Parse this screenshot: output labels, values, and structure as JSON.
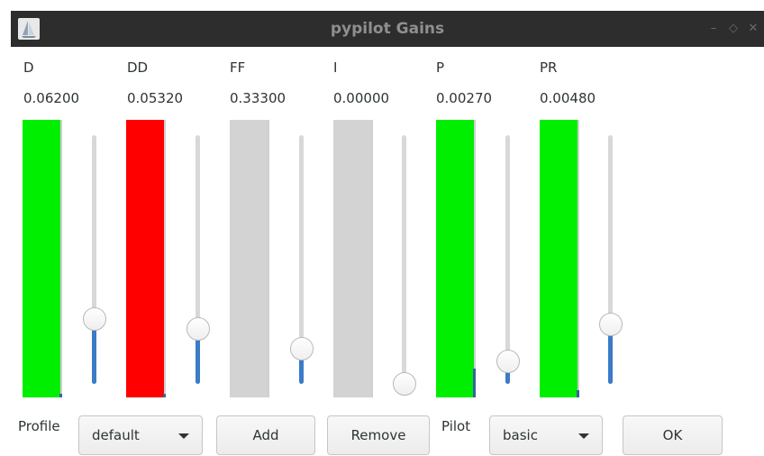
{
  "window": {
    "title": "pypilot Gains"
  },
  "gains": [
    {
      "name": "D",
      "value": "0.06200",
      "bar_color": "#00ee00",
      "bar_fill": 1.0,
      "slider_level": 0.26
    },
    {
      "name": "DD",
      "value": "0.05320",
      "bar_color": "#ff0000",
      "bar_fill": 1.0,
      "slider_level": 0.22
    },
    {
      "name": "FF",
      "value": "0.33300",
      "bar_color": "#d3d3d3",
      "bar_fill": 0.0,
      "slider_level": 0.14
    },
    {
      "name": "I",
      "value": "0.00000",
      "bar_color": "#d3d3d3",
      "bar_fill": 0.0,
      "slider_level": 0.0
    },
    {
      "name": "P",
      "value": "0.00270",
      "bar_color": "#00ee00",
      "bar_fill": 1.0,
      "slider_level": 0.09
    },
    {
      "name": "PR",
      "value": "0.00480",
      "bar_color": "#00ee00",
      "bar_fill": 1.0,
      "slider_level": 0.24
    }
  ],
  "bottom": {
    "profile_label": "Profile",
    "profile_value": "default",
    "add_label": "Add",
    "remove_label": "Remove",
    "pilot_label": "Pilot",
    "pilot_value": "basic",
    "ok_label": "OK"
  },
  "colors": {
    "slider_accent": "#3b7bc8",
    "titlebar": "#2d2d2d"
  },
  "icons": {
    "app": "sailboat-icon"
  }
}
